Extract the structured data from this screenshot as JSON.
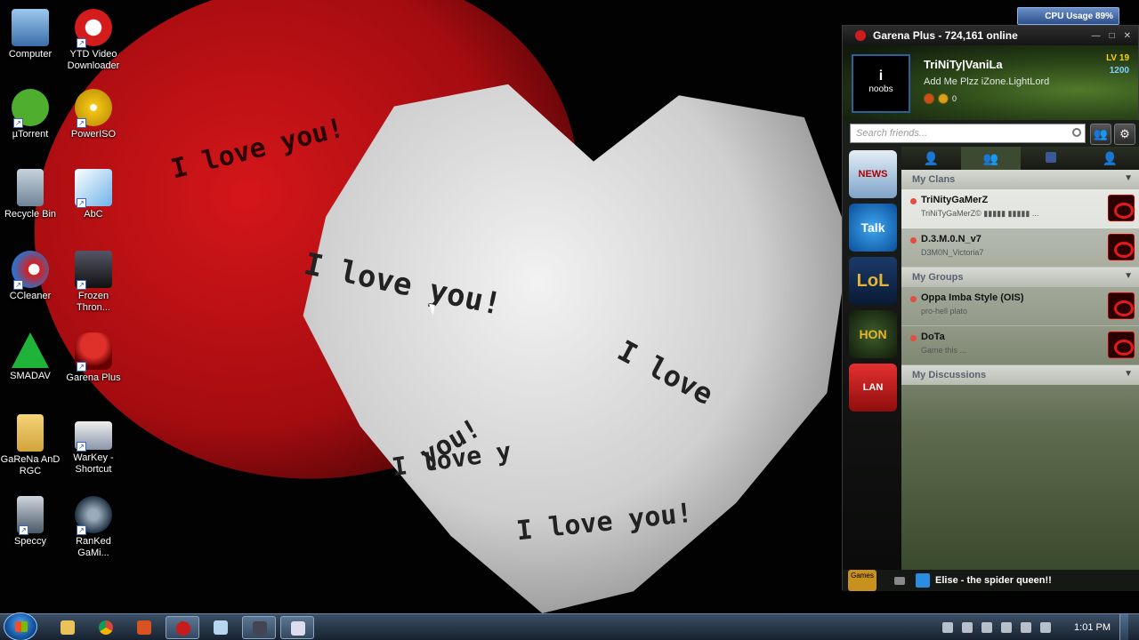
{
  "desktop": {
    "icons": [
      {
        "label": "Computer"
      },
      {
        "label": "YTD Video Downloader"
      },
      {
        "label": "µTorrent"
      },
      {
        "label": "PowerISO"
      },
      {
        "label": "Recycle Bin"
      },
      {
        "label": "AbC"
      },
      {
        "label": "CCleaner"
      },
      {
        "label": "Frozen Thron..."
      },
      {
        "label": "SMADAV"
      },
      {
        "label": "Garena Plus"
      },
      {
        "label": "GaReNa AnD RGC"
      },
      {
        "label": "WarKey - Shortcut"
      },
      {
        "label": "Speccy"
      },
      {
        "label": "RanKed GaMi..."
      }
    ],
    "wallpaper_text": [
      "I love you!",
      "I love you!",
      "I love you!",
      "I love",
      "you!",
      "I love y"
    ]
  },
  "cpu_gadget": {
    "label": "CPU Usage 89%"
  },
  "garena": {
    "title": "Garena Plus - 724,161 online",
    "profile": {
      "avatar_top": "i",
      "avatar_text": "noobs",
      "username": "TriNiTy|VaniLa",
      "status": "Add Me Plzz iZone.LightLord",
      "badge_count": "0",
      "level": "LV 19",
      "points": "1200"
    },
    "search": {
      "placeholder": "Search friends..."
    },
    "apps": [
      {
        "label": "NEWS"
      },
      {
        "label": "Talk"
      },
      {
        "label": "LoL"
      },
      {
        "label": "HON"
      },
      {
        "label": "LAN"
      }
    ],
    "sections": {
      "clans": "My Clans",
      "groups": "My Groups",
      "discussions": "My Discussions"
    },
    "clans": [
      {
        "name": "TriNityGaMerZ",
        "sub": "TriNiTyGaMerZ© ▮▮▮▮▮ ▮▮▮▮▮ ..."
      },
      {
        "name": "D.3.M.0.N_v7",
        "sub": "D3M0N_Victoria7"
      }
    ],
    "groups": [
      {
        "name": "Oppa Imba Style (OIS)",
        "sub": "pro-hell plato"
      },
      {
        "name": "DoTa",
        "sub": "Game this ..."
      }
    ],
    "bottom": {
      "games_label": "Games",
      "news_text": "Elise - the spider queen!!"
    }
  },
  "taskbar": {
    "time": "1:01 PM"
  }
}
